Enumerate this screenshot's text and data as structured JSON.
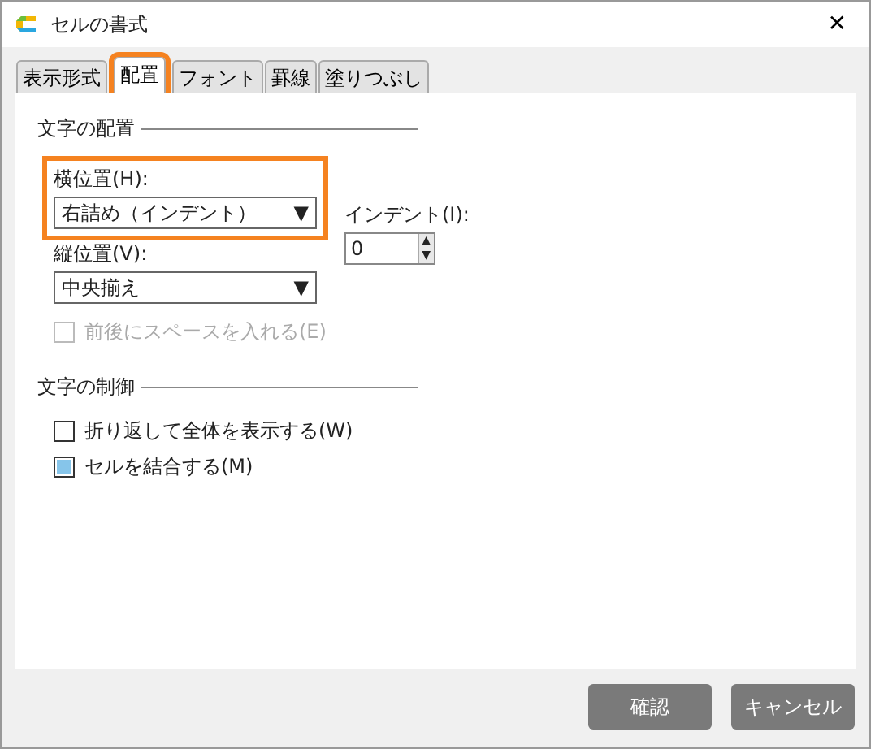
{
  "window": {
    "title": "セルの書式",
    "close": "✕"
  },
  "tabs": [
    {
      "label": "表示形式",
      "selected": false,
      "highlighted": false
    },
    {
      "label": "配置",
      "selected": true,
      "highlighted": true
    },
    {
      "label": "フォント",
      "selected": false,
      "highlighted": false
    },
    {
      "label": "罫線",
      "selected": false,
      "highlighted": false
    },
    {
      "label": "塗りつぶし",
      "selected": false,
      "highlighted": false
    }
  ],
  "alignment": {
    "heading": "文字の配置",
    "horizontal": {
      "label": "横位置(H):",
      "value": "右詰め（インデント）",
      "arrow": "▼",
      "highlighted": true
    },
    "vertical": {
      "label": "縦位置(V):",
      "value": "中央揃え",
      "arrow": "▼"
    },
    "indent": {
      "label": "インデント(I):",
      "value": "0",
      "up": "▲",
      "down": "▼"
    },
    "space_option": {
      "label": "前後にスペースを入れる(E)",
      "checked": false,
      "disabled": true
    }
  },
  "control": {
    "heading": "文字の制御",
    "options": [
      {
        "label": "折り返して全体を表示する(W)",
        "checked": false,
        "disabled": false
      },
      {
        "label": "セルを結合する(M)",
        "checked": true,
        "disabled": false
      }
    ]
  },
  "buttons": [
    "確認",
    "キャンセル"
  ]
}
